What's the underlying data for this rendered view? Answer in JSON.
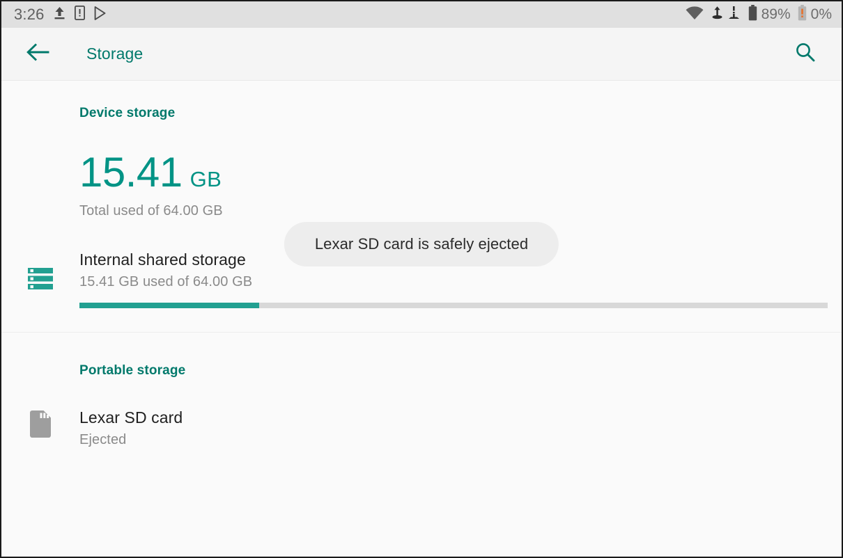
{
  "status_bar": {
    "clock": "3:26",
    "icons": [
      {
        "name": "upload-icon"
      },
      {
        "name": "device-alert-icon"
      },
      {
        "name": "play-store-icon"
      }
    ],
    "right_icons": [
      {
        "name": "wifi-icon"
      },
      {
        "name": "stylus-charging-icon"
      },
      {
        "name": "stylus-alert-icon"
      }
    ],
    "battery_primary_label": "89%",
    "battery_secondary_label": "0%",
    "colors": {
      "bar_bg": "#e0e0e0",
      "icon": "#5f5f5f",
      "warning": "#e8702a"
    }
  },
  "app_bar": {
    "back_icon": "arrow-back-icon",
    "title": "Storage",
    "search_icon": "search-icon",
    "accent": "#00796b"
  },
  "sections": [
    {
      "header": "Device storage",
      "summary": {
        "value": "15.41",
        "unit": "GB",
        "subtitle": "Total used of 64.00 GB"
      },
      "volumes": [
        {
          "icon": "internal-storage-icon",
          "title": "Internal shared storage",
          "subtitle": "15.41 GB used of 64.00 GB",
          "progress_percent": 24,
          "progress_color": "#22a091",
          "track_color": "#d8d8d8"
        }
      ]
    },
    {
      "header": "Portable storage",
      "volumes": [
        {
          "icon": "sd-card-icon",
          "title": "Lexar SD card",
          "subtitle": "Ejected",
          "icon_color": "#9e9e9e"
        }
      ]
    }
  ],
  "toast": {
    "message": "Lexar SD card is safely ejected"
  }
}
